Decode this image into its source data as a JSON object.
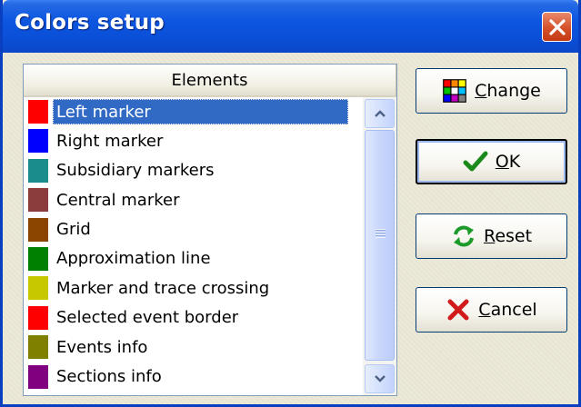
{
  "window": {
    "title": "Colors setup",
    "close_icon": "close-x-icon"
  },
  "list": {
    "column_header": "Elements",
    "selected_index": 0,
    "items": [
      {
        "label": "Left marker",
        "color": "#ff0000"
      },
      {
        "label": "Right marker",
        "color": "#0000ff"
      },
      {
        "label": "Subsidiary markers",
        "color": "#1b8c8c"
      },
      {
        "label": "Central marker",
        "color": "#8b3c3c"
      },
      {
        "label": "Grid",
        "color": "#8b4500"
      },
      {
        "label": "Approximation line",
        "color": "#008000"
      },
      {
        "label": "Marker and trace crossing",
        "color": "#c8c800"
      },
      {
        "label": "Selected event border",
        "color": "#ff0000"
      },
      {
        "label": "Events info",
        "color": "#808000"
      },
      {
        "label": "Sections info",
        "color": "#800080"
      }
    ]
  },
  "buttons": {
    "change": {
      "mnemonic": "C",
      "rest": "hange",
      "icon": "color-grid-icon"
    },
    "ok": {
      "mnemonic": "O",
      "rest": "K",
      "icon": "green-checkmark-icon"
    },
    "reset": {
      "mnemonic": "R",
      "rest": "eset",
      "icon": "refresh-arrows-icon"
    },
    "cancel": {
      "mnemonic": "C",
      "rest": "ancel",
      "icon": "red-x-icon"
    }
  }
}
